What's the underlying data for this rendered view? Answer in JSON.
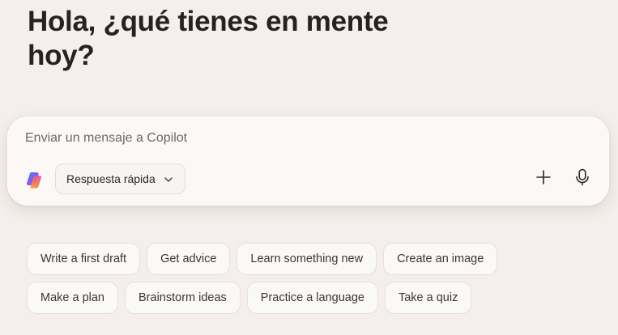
{
  "greeting": "Hola, ¿qué tienes en mente hoy?",
  "composer": {
    "placeholder": "Enviar un mensaje a Copilot",
    "mode_label": "Respuesta rápida",
    "mode_icon": "chevron-down-icon",
    "add_icon": "plus-icon",
    "mic_icon": "microphone-icon",
    "logo_icon": "copilot-logo-icon"
  },
  "suggestions": {
    "row1": [
      "Write a first draft",
      "Get advice",
      "Learn something new",
      "Create an image"
    ],
    "row2": [
      "Make a plan",
      "Brainstorm ideas",
      "Practice a language",
      "Take a quiz"
    ]
  },
  "colors": {
    "background": "#f4efec",
    "composer_bg": "#fbf8f6",
    "text": "#27211f"
  }
}
